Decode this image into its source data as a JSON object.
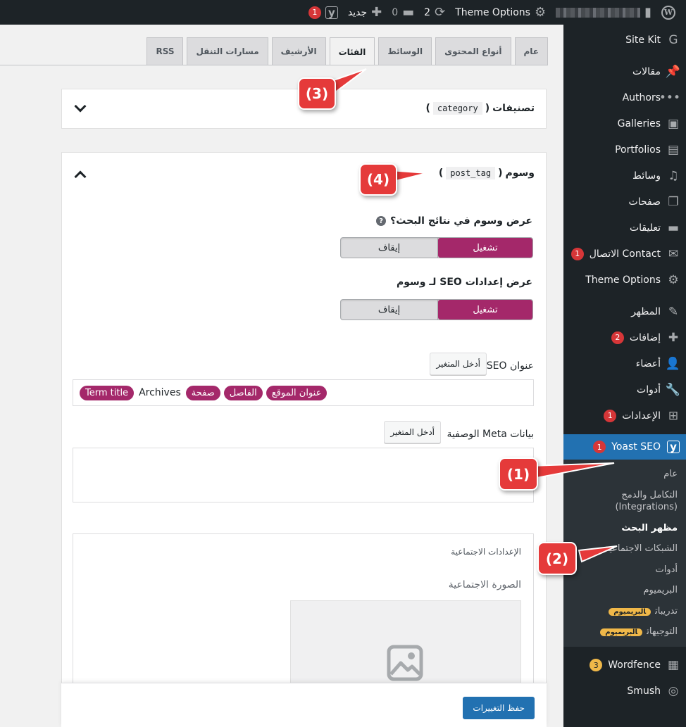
{
  "admin_bar": {
    "theme_options": "Theme Options",
    "updates_count": "2",
    "comments_count": "0",
    "new_label": "جديد",
    "yoast_count": "1"
  },
  "tabs": [
    {
      "label": "عام"
    },
    {
      "label": "أنواع المحتوى"
    },
    {
      "label": "الوسائط"
    },
    {
      "label": "الفئات",
      "active": true
    },
    {
      "label": "الأرشيف"
    },
    {
      "label": "مسارات التنقل"
    },
    {
      "label": "RSS"
    }
  ],
  "panels": {
    "category": {
      "title": "تصنيفات",
      "code": "category",
      "open_paren": "(",
      "close_paren": ")"
    },
    "tag": {
      "title": "وسوم",
      "code": "post_tag",
      "open_paren": "(",
      "close_paren": ")"
    }
  },
  "tag_settings": {
    "show_in_search_label": "عرض وسوم في نتائج البحث؟",
    "help_mark": "?",
    "show_seo_label": "عرض إعدادات SEO لـ وسوم",
    "toggle_on": "تشغيل",
    "toggle_off": "إيقاف",
    "seo_title_label": "عنوان SEO",
    "insert_variable": "أدخل المتغير",
    "seo_title_tokens": [
      {
        "text": "Term title",
        "chip": true
      },
      {
        "text": "Archives",
        "chip": false
      },
      {
        "text": "صفحة",
        "chip": true
      },
      {
        "text": "الفاصل",
        "chip": true
      },
      {
        "text": "عنوان الموقع",
        "chip": true
      }
    ],
    "meta_label": "بيانات Meta الوصفية",
    "social_settings": "الإعدادات الاجتماعية",
    "social_image": "الصورة الاجتماعية",
    "save_button": "حفظ التغييرات"
  },
  "sidebar": {
    "items": [
      {
        "label": "Site Kit",
        "icon": "G"
      },
      {
        "label": "مقالات",
        "icon": "📌"
      },
      {
        "label": "Authors",
        "icon": "•••"
      },
      {
        "label": "Galleries",
        "icon": "▣"
      },
      {
        "label": "Portfolios",
        "icon": "▤"
      },
      {
        "label": "وسائط",
        "icon": "♫"
      },
      {
        "label": "صفحات",
        "icon": "❐"
      },
      {
        "label": "تعليقات",
        "icon": "▬"
      },
      {
        "label": "Contact الاتصال",
        "icon": "✉",
        "badge": "1"
      },
      {
        "label": "Theme Options",
        "icon": "⚙"
      },
      {
        "label": "المظهر",
        "icon": "✎"
      },
      {
        "label": "إضافات",
        "icon": "✚",
        "badge": "2"
      },
      {
        "label": "أعضاء",
        "icon": "👤"
      },
      {
        "label": "أدوات",
        "icon": "🔧"
      },
      {
        "label": "الإعدادات",
        "icon": "⊞",
        "badge": "1"
      }
    ],
    "yoast": {
      "label": "Yoast SEO",
      "badge": "1",
      "icon": "y"
    },
    "yoast_sub": [
      {
        "label": "عام"
      },
      {
        "label": "التكامل والدمج (Integrations)"
      },
      {
        "label": "مظهر البحث",
        "current": true
      },
      {
        "label": "الشبكات الاجتماعية"
      },
      {
        "label": "أدوات"
      },
      {
        "label": "البريميوم"
      },
      {
        "label": "تدريبات",
        "premium": "البريميوم"
      },
      {
        "label": "التوجيهات",
        "premium": "البريميوم"
      }
    ],
    "after": [
      {
        "label": "Wordfence",
        "icon": "▦",
        "badge": "3"
      },
      {
        "label": "Smush",
        "icon": "◎"
      }
    ]
  },
  "callouts": [
    "(1)",
    "(2)",
    "(3)",
    "(4)"
  ],
  "colors": {
    "yoast_accent": "#a4286a",
    "wp_blue": "#2271b1",
    "callout_red": "#e53a3a"
  }
}
